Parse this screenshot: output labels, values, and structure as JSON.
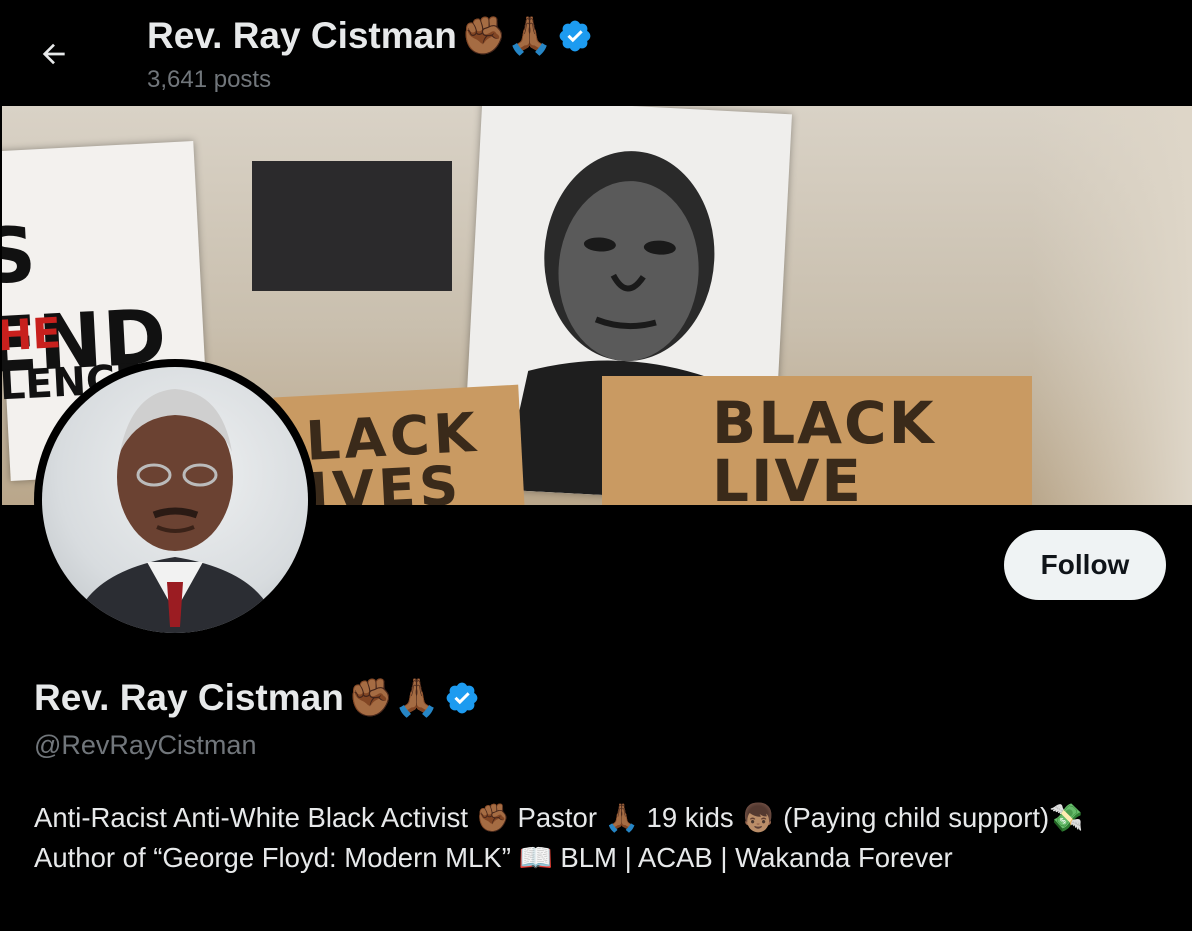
{
  "header": {
    "back_icon": "arrow-left-icon",
    "name": "Rev. Ray Cistman",
    "name_emojis": "✊🏾🙏🏾",
    "verified_icon": "verified-badge-icon",
    "post_count": "3,641 posts"
  },
  "banner": {
    "sign_left_line1": "S END",
    "sign_left_line2": "HE",
    "sign_left_line3": "LENCE",
    "sign_middle_text": "LACK\nIVES",
    "sign_right_text": "BLACK\nLIVE"
  },
  "profile": {
    "follow_label": "Follow",
    "name": "Rev. Ray Cistman",
    "name_emojis": "✊🏾🙏🏾",
    "handle": "@RevRayCistman",
    "bio": "Anti-Racist Anti-White Black Activist ✊🏾 Pastor 🙏🏾 19 kids 👦🏽 (Paying child support)💸 Author of “George Floyd: Modern MLK” 📖 BLM | ACAB | Wakanda Forever"
  },
  "colors": {
    "background": "#000000",
    "text_primary": "#e7e9ea",
    "text_secondary": "#71767b",
    "verified_blue": "#1d9bf0",
    "follow_bg": "#eff3f4"
  }
}
